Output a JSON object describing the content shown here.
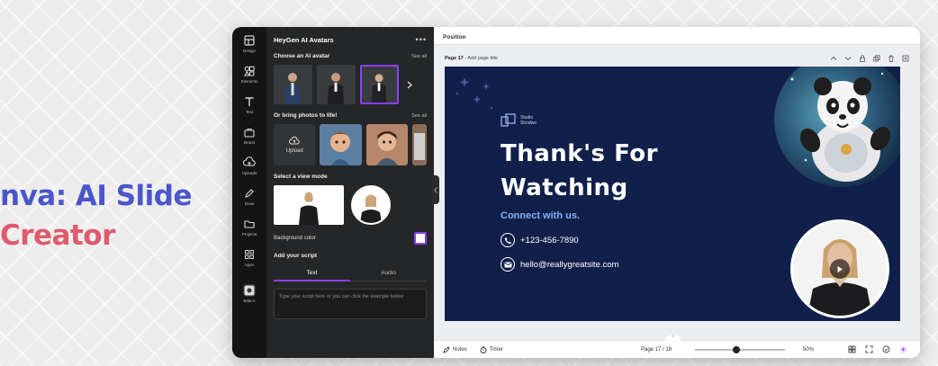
{
  "headline": {
    "line1": "nva: AI Slide",
    "line2": "Creator"
  },
  "colors": {
    "headline1": "#4a56c9",
    "headline2": "#e05a6e",
    "accent": "#8b3dff",
    "slide_bg": "#11204a",
    "connect": "#7fb2ff"
  },
  "rail": [
    {
      "label": "Design",
      "icon": "design-icon"
    },
    {
      "label": "Elements",
      "icon": "elements-icon"
    },
    {
      "label": "Text",
      "icon": "text-icon"
    },
    {
      "label": "Brand",
      "icon": "brand-icon"
    },
    {
      "label": "Uploads",
      "icon": "uploads-icon"
    },
    {
      "label": "Draw",
      "icon": "draw-icon"
    },
    {
      "label": "Projects",
      "icon": "projects-icon"
    },
    {
      "label": "Apps",
      "icon": "apps-icon"
    },
    {
      "label": "Bitta A",
      "icon": "app-icon"
    }
  ],
  "panel": {
    "title": "HeyGen AI Avatars",
    "menu": "•••",
    "choose_title": "Choose an AI avatar",
    "see_all_1": "See all",
    "photos_title": "Or bring photos to life!",
    "see_all_2": "See all",
    "upload_label": "Upload",
    "view_mode_title": "Select a view mode",
    "bg_color_label": "Background color",
    "script_title": "Add your script",
    "tab_text": "Text",
    "tab_audio": "Audio",
    "script_placeholder": "Type your script here or you can click the example below"
  },
  "editor": {
    "top_title": "Position",
    "page_label_bold": "Page 17",
    "page_label_rest": " - Add page title"
  },
  "slide": {
    "brand_line1": "Studio",
    "brand_line2": "Shodwe",
    "title_line1": "Thank's For",
    "title_line2": "Watching",
    "connect": "Connect with us.",
    "phone": "+123-456-7890",
    "email": "hello@reallygreatsite.com"
  },
  "statusbar": {
    "notes": "Notes",
    "timer": "Timer",
    "page_count": "Page 17 / 18",
    "zoom": "50%",
    "zoom_fraction": 0.42
  }
}
